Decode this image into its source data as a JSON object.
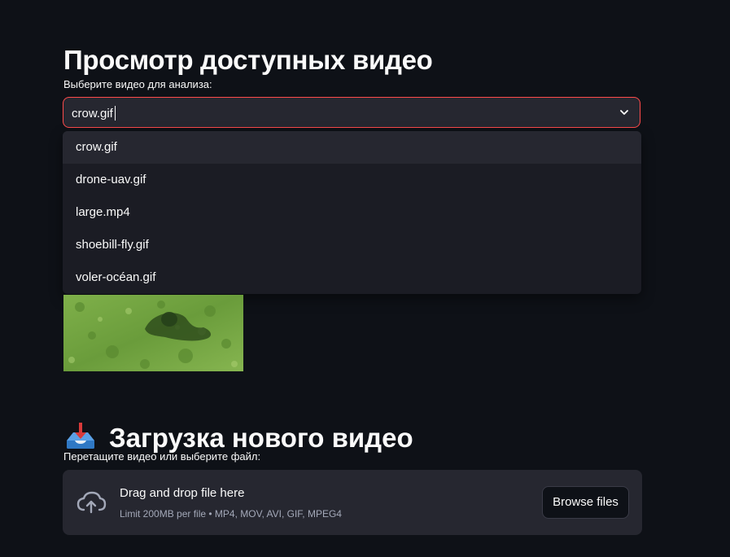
{
  "header": {
    "title": "Просмотр доступных видео"
  },
  "video_select": {
    "label": "Выберите видео для анализа:",
    "value": "crow.gif",
    "options": [
      "crow.gif",
      "drone-uav.gif",
      "large.mp4",
      "shoebill-fly.gif",
      "voler-océan.gif"
    ],
    "highlighted_option": "crow.gif",
    "accent_color": "#ff4b4b"
  },
  "upload": {
    "icon": "inbox-tray-emoji",
    "title": "Загрузка нового видео",
    "label": "Перетащите видео или выберите файл:",
    "dropzone": {
      "icon": "cloud-upload-icon",
      "main_text": "Drag and drop file here",
      "sub_text": "Limit 200MB per file • MP4, MOV, AVI, GIF, MPEG4",
      "button_label": "Browse files"
    }
  },
  "colors": {
    "background": "#0e1117",
    "surface": "#262730",
    "dropdown": "#1b1c24",
    "accent": "#ff4b4b"
  }
}
